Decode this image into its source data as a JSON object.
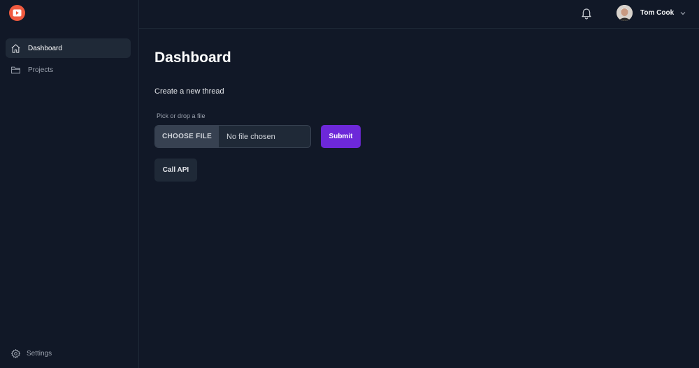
{
  "app": {
    "logo_icon": "play-icon",
    "accent": "#f05a3f"
  },
  "sidebar": {
    "items": [
      {
        "label": "Dashboard",
        "icon": "home-icon",
        "active": true
      },
      {
        "label": "Projects",
        "icon": "folder-icon",
        "active": false
      }
    ],
    "settings_label": "Settings",
    "settings_icon": "gear-icon"
  },
  "topbar": {
    "notification_icon": "bell-icon",
    "user_name": "Tom Cook",
    "user_menu_icon": "chevron-down-icon"
  },
  "main": {
    "title": "Dashboard",
    "section_title": "Create a new thread",
    "file_label": "Pick or drop a file",
    "file_button": "CHOOSE FILE",
    "file_status": "No file chosen",
    "submit_label": "Submit",
    "call_api_label": "Call API",
    "submit_color": "#6d28d9"
  }
}
